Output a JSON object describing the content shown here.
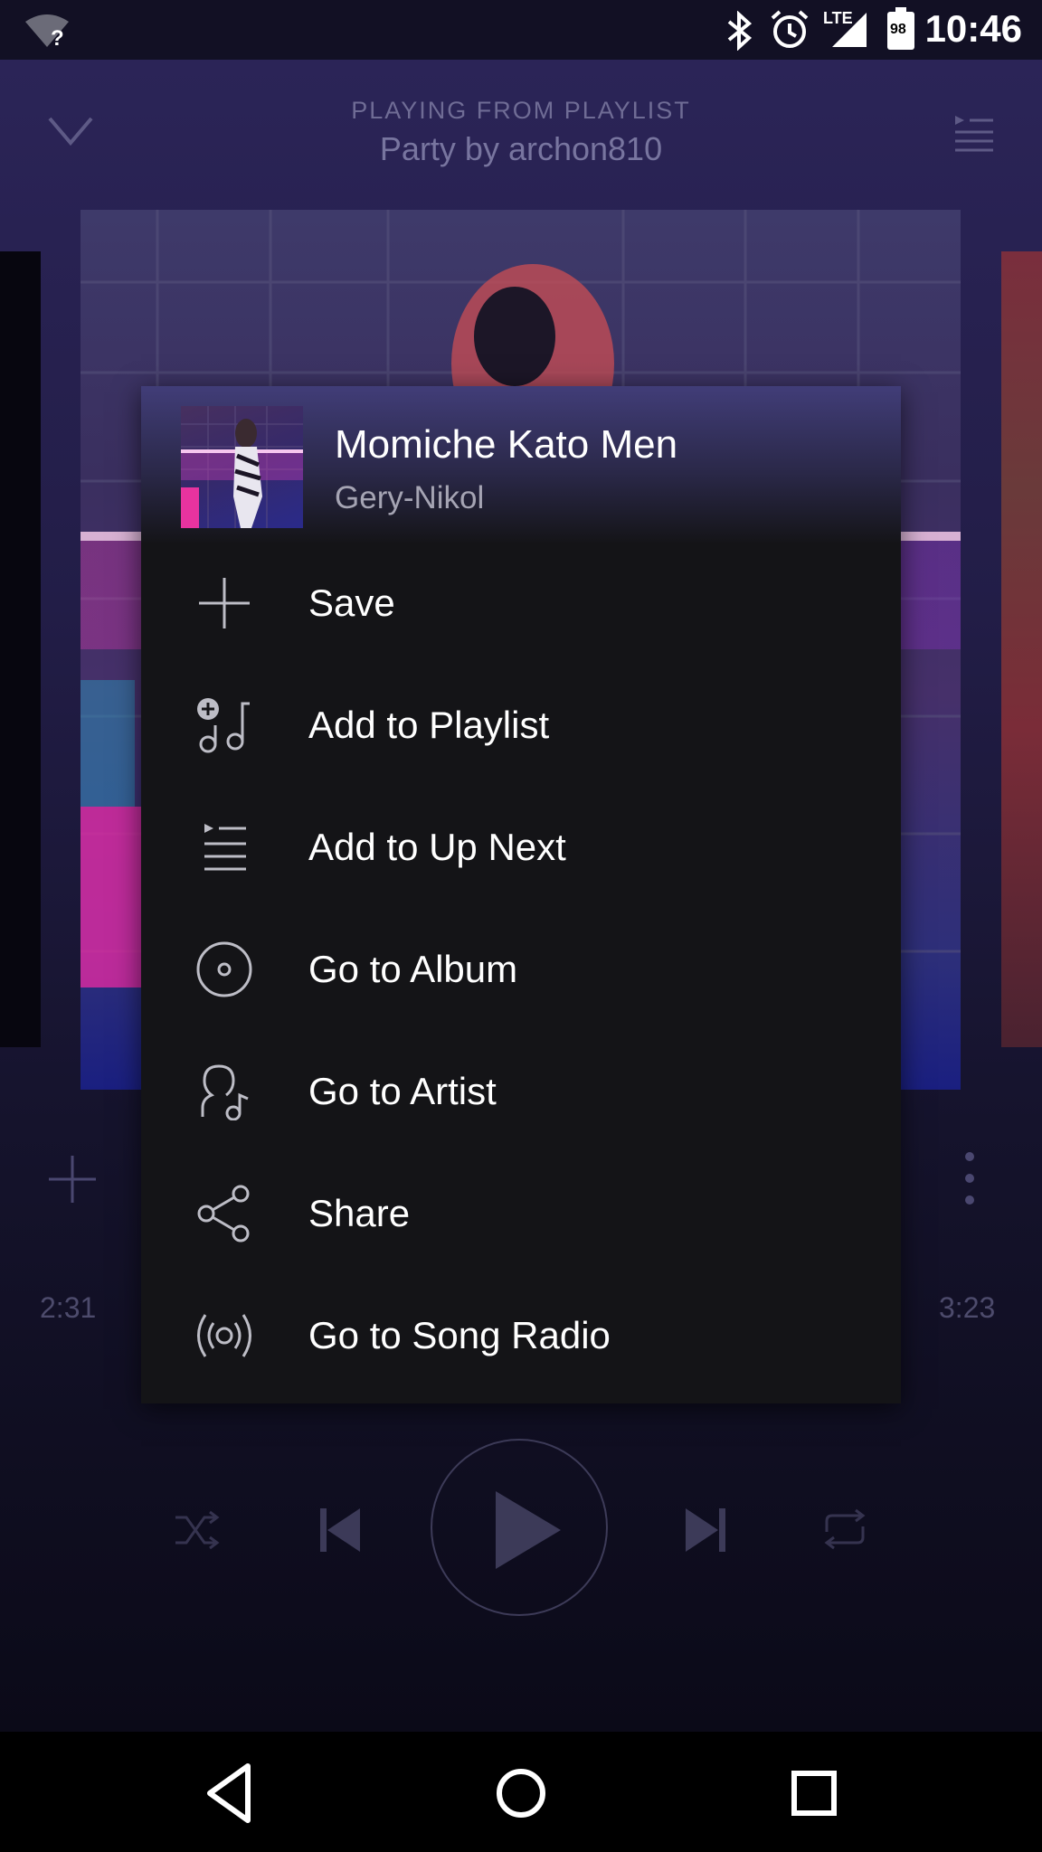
{
  "status_bar": {
    "time": "10:46",
    "network_label": "LTE",
    "battery_level": "98",
    "icons": [
      "wifi-question-icon",
      "bluetooth-icon",
      "alarm-icon",
      "signal-icon",
      "battery-icon"
    ]
  },
  "player": {
    "playing_from_label": "PLAYING FROM PLAYLIST",
    "playlist_name": "Party by archon810",
    "elapsed_time": "2:31",
    "total_time": "3:23"
  },
  "context_menu": {
    "track_title": "Momiche Kato Men",
    "artist": "Gery-Nikol",
    "items": [
      {
        "label": "Save",
        "icon": "plus-icon"
      },
      {
        "label": "Add to Playlist",
        "icon": "add-to-playlist-icon"
      },
      {
        "label": "Add to Up Next",
        "icon": "queue-icon"
      },
      {
        "label": "Go to Album",
        "icon": "album-icon"
      },
      {
        "label": "Go to Artist",
        "icon": "artist-icon"
      },
      {
        "label": "Share",
        "icon": "share-icon"
      },
      {
        "label": "Go to Song Radio",
        "icon": "radio-icon"
      }
    ]
  },
  "colors": {
    "menu_background": "#141417",
    "player_background": "#221d47",
    "menu_header_accent": "#413d78"
  }
}
